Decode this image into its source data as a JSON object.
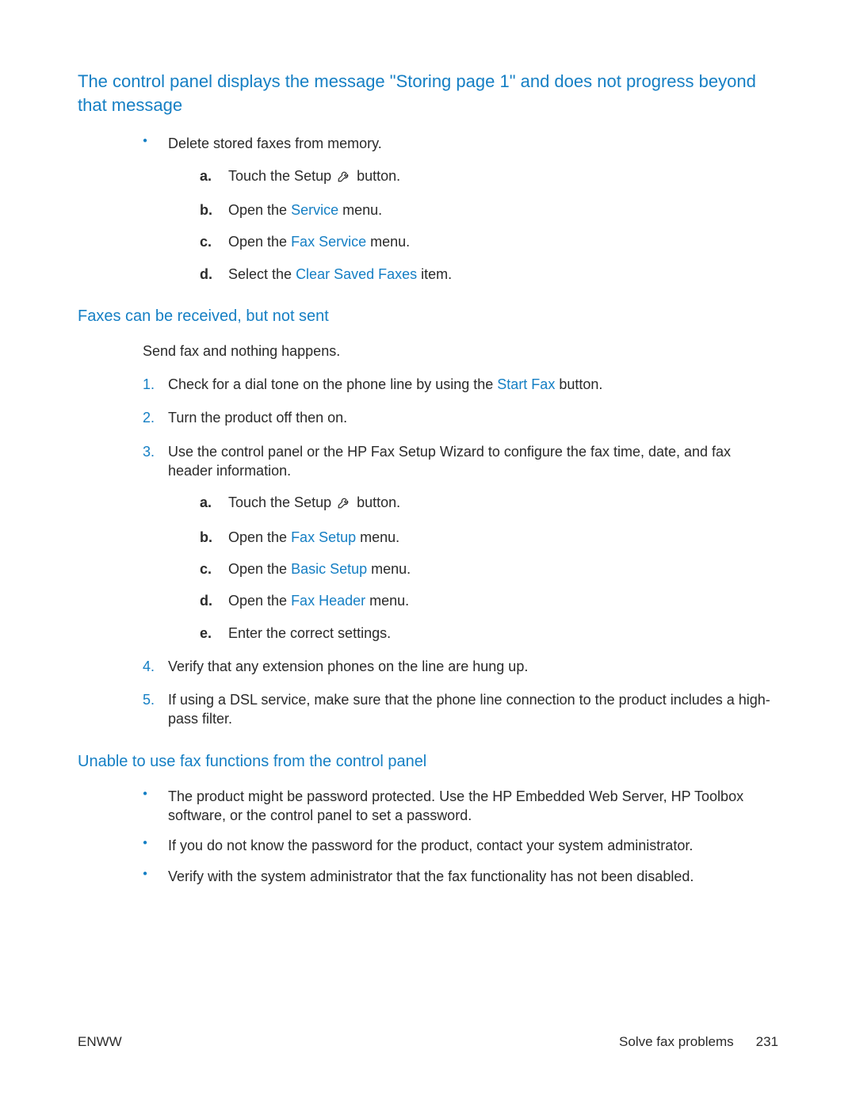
{
  "section1": {
    "heading": "The control panel displays the message \"Storing page 1\" and does not progress beyond that message",
    "bullet1": "Delete stored faxes from memory.",
    "steps": {
      "a_prefix": "Touch the Setup",
      "a_suffix": "button.",
      "b_prefix": "Open the ",
      "b_link": "Service",
      "b_suffix": " menu.",
      "c_prefix": "Open the ",
      "c_link": "Fax Service",
      "c_suffix": " menu.",
      "d_prefix": "Select the ",
      "d_link": "Clear Saved Faxes",
      "d_suffix": " item."
    }
  },
  "section2": {
    "heading": "Faxes can be received, but not sent",
    "intro": "Send fax and nothing happens.",
    "step1_prefix": "Check for a dial tone on the phone line by using the ",
    "step1_link": "Start Fax",
    "step1_suffix": " button.",
    "step2": "Turn the product off then on.",
    "step3": "Use the control panel or the HP Fax Setup Wizard to configure the fax time, date, and fax header information.",
    "sub": {
      "a_prefix": "Touch the Setup",
      "a_suffix": "button.",
      "b_prefix": "Open the ",
      "b_link": "Fax Setup",
      "b_suffix": " menu.",
      "c_prefix": "Open the ",
      "c_link": "Basic Setup",
      "c_suffix": " menu.",
      "d_prefix": "Open the ",
      "d_link": "Fax Header",
      "d_suffix": " menu.",
      "e": "Enter the correct settings."
    },
    "step4": "Verify that any extension phones on the line are hung up.",
    "step5": "If using a DSL service, make sure that the phone line connection to the product includes a high-pass filter."
  },
  "section3": {
    "heading": "Unable to use fax functions from the control panel",
    "bullet1": "The product might be password protected. Use the HP Embedded Web Server, HP Toolbox software, or the control panel to set a password.",
    "bullet2": "If you do not know the password for the product, contact your system administrator.",
    "bullet3": "Verify with the system administrator that the fax functionality has not been disabled."
  },
  "markers": {
    "a": "a.",
    "b": "b.",
    "c": "c.",
    "d": "d.",
    "e": "e.",
    "n1": "1.",
    "n2": "2.",
    "n3": "3.",
    "n4": "4.",
    "n5": "5."
  },
  "footer": {
    "left": "ENWW",
    "rightLabel": "Solve fax problems",
    "pageNum": "231"
  }
}
